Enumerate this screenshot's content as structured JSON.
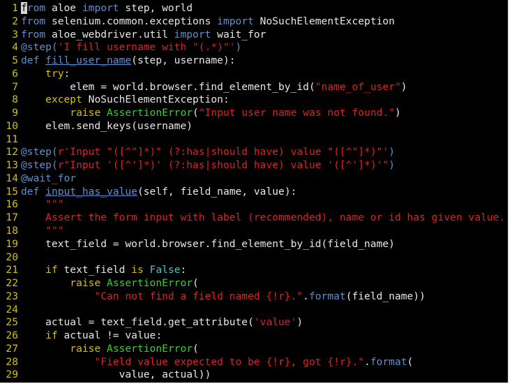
{
  "editor": {
    "colors": {
      "background": "#000000",
      "line_number": "#d7c100",
      "plain": "#e7e7e7",
      "keyword": "#5d8fd1",
      "keyword_alt": "#d8c000",
      "string": "#dc2222",
      "exception": "#3dc93d",
      "builtin_value": "#47c0c8"
    },
    "lines": [
      {
        "n": "1",
        "tokens": [
          {
            "t": "f",
            "k": "cursor"
          },
          {
            "t": "rom",
            "k": "keyword"
          },
          {
            "t": " aloe ",
            "k": "plain"
          },
          {
            "t": "import",
            "k": "keyword"
          },
          {
            "t": " step, world",
            "k": "plain"
          }
        ]
      },
      {
        "n": "2",
        "tokens": [
          {
            "t": "from",
            "k": "keyword"
          },
          {
            "t": " selenium.common.exceptions ",
            "k": "plain"
          },
          {
            "t": "import",
            "k": "keyword"
          },
          {
            "t": " NoSuchElementException",
            "k": "plain"
          }
        ]
      },
      {
        "n": "3",
        "tokens": [
          {
            "t": "from",
            "k": "keyword"
          },
          {
            "t": " aloe_webdriver.util ",
            "k": "plain"
          },
          {
            "t": "import",
            "k": "keyword"
          },
          {
            "t": " wait_for",
            "k": "plain"
          }
        ]
      },
      {
        "n": "4",
        "tokens": [
          {
            "t": "@step(",
            "k": "decorator"
          },
          {
            "t": "'I fill username with \"(.*)\"'",
            "k": "string"
          },
          {
            "t": ")",
            "k": "decorator"
          }
        ]
      },
      {
        "n": "5",
        "tokens": [
          {
            "t": "def",
            "k": "keyword"
          },
          {
            "t": " ",
            "k": "plain"
          },
          {
            "t": "fill_user_name",
            "k": "func"
          },
          {
            "t": "(step, username):",
            "k": "plain"
          }
        ]
      },
      {
        "n": "6",
        "tokens": [
          {
            "t": "    ",
            "k": "plain"
          },
          {
            "t": "try",
            "k": "keyword2"
          },
          {
            "t": ":",
            "k": "plain"
          }
        ]
      },
      {
        "n": "7",
        "tokens": [
          {
            "t": "        elem = world.browser.find_element_by_id(",
            "k": "plain"
          },
          {
            "t": "\"name_of_user\"",
            "k": "string"
          },
          {
            "t": ")",
            "k": "plain"
          }
        ]
      },
      {
        "n": "8",
        "tokens": [
          {
            "t": "    ",
            "k": "plain"
          },
          {
            "t": "except",
            "k": "keyword2"
          },
          {
            "t": " NoSuchElementException:",
            "k": "plain"
          }
        ]
      },
      {
        "n": "9",
        "tokens": [
          {
            "t": "        ",
            "k": "plain"
          },
          {
            "t": "raise",
            "k": "keyword2"
          },
          {
            "t": " ",
            "k": "plain"
          },
          {
            "t": "AssertionError",
            "k": "exception"
          },
          {
            "t": "(",
            "k": "plain"
          },
          {
            "t": "\"Input user name was not found.\"",
            "k": "string"
          },
          {
            "t": ")",
            "k": "plain"
          }
        ]
      },
      {
        "n": "10",
        "tokens": [
          {
            "t": "    elem.send_keys(username)",
            "k": "plain"
          }
        ]
      },
      {
        "n": "11",
        "tokens": []
      },
      {
        "n": "12",
        "tokens": [
          {
            "t": "@step(",
            "k": "decorator"
          },
          {
            "t": "r'Input \"([^\"]*)\" (?:has|should have) value \"([^\"]*)\"'",
            "k": "string"
          },
          {
            "t": ")",
            "k": "decorator"
          }
        ]
      },
      {
        "n": "13",
        "tokens": [
          {
            "t": "@step(",
            "k": "decorator"
          },
          {
            "t": "r\"Input '([^']*)' (?:has|should have) value '([^']*)'\"",
            "k": "string"
          },
          {
            "t": ")",
            "k": "decorator"
          }
        ]
      },
      {
        "n": "14",
        "tokens": [
          {
            "t": "@wait_for",
            "k": "decorator"
          }
        ]
      },
      {
        "n": "15",
        "tokens": [
          {
            "t": "def",
            "k": "keyword"
          },
          {
            "t": " ",
            "k": "plain"
          },
          {
            "t": "input_has_value",
            "k": "func"
          },
          {
            "t": "(self, field_name, value):",
            "k": "plain"
          }
        ]
      },
      {
        "n": "16",
        "tokens": [
          {
            "t": "    ",
            "k": "plain"
          },
          {
            "t": "\"\"\"",
            "k": "string"
          }
        ]
      },
      {
        "n": "17",
        "tokens": [
          {
            "t": "    ",
            "k": "plain"
          },
          {
            "t": "Assert the form input with label (recommended), name or id has given value.",
            "k": "string"
          }
        ]
      },
      {
        "n": "18",
        "tokens": [
          {
            "t": "    ",
            "k": "plain"
          },
          {
            "t": "\"\"\"",
            "k": "string"
          }
        ]
      },
      {
        "n": "19",
        "tokens": [
          {
            "t": "    text_field = world.browser.find_element_by_id(field_name)",
            "k": "plain"
          }
        ]
      },
      {
        "n": "20",
        "tokens": []
      },
      {
        "n": "21",
        "tokens": [
          {
            "t": "    ",
            "k": "plain"
          },
          {
            "t": "if",
            "k": "keyword2"
          },
          {
            "t": " text_field ",
            "k": "plain"
          },
          {
            "t": "is",
            "k": "keyword2"
          },
          {
            "t": " ",
            "k": "plain"
          },
          {
            "t": "False",
            "k": "bool"
          },
          {
            "t": ":",
            "k": "plain"
          }
        ]
      },
      {
        "n": "22",
        "tokens": [
          {
            "t": "        ",
            "k": "plain"
          },
          {
            "t": "raise",
            "k": "keyword2"
          },
          {
            "t": " ",
            "k": "plain"
          },
          {
            "t": "AssertionError",
            "k": "exception"
          },
          {
            "t": "(",
            "k": "plain"
          }
        ]
      },
      {
        "n": "23",
        "tokens": [
          {
            "t": "            ",
            "k": "plain"
          },
          {
            "t": "\"Can not find a field named {!r}.\"",
            "k": "string"
          },
          {
            "t": ".",
            "k": "plain"
          },
          {
            "t": "format",
            "k": "method"
          },
          {
            "t": "(field_name))",
            "k": "plain"
          }
        ]
      },
      {
        "n": "24",
        "tokens": []
      },
      {
        "n": "25",
        "tokens": [
          {
            "t": "    actual = text_field.get_attribute(",
            "k": "plain"
          },
          {
            "t": "'value'",
            "k": "string"
          },
          {
            "t": ")",
            "k": "plain"
          }
        ]
      },
      {
        "n": "26",
        "tokens": [
          {
            "t": "    ",
            "k": "plain"
          },
          {
            "t": "if",
            "k": "keyword2"
          },
          {
            "t": " actual != value:",
            "k": "plain"
          }
        ]
      },
      {
        "n": "27",
        "tokens": [
          {
            "t": "        ",
            "k": "plain"
          },
          {
            "t": "raise",
            "k": "keyword2"
          },
          {
            "t": " ",
            "k": "plain"
          },
          {
            "t": "AssertionError",
            "k": "exception"
          },
          {
            "t": "(",
            "k": "plain"
          }
        ]
      },
      {
        "n": "28",
        "tokens": [
          {
            "t": "            ",
            "k": "plain"
          },
          {
            "t": "\"Field value expected to be {!r}, got {!r}.\"",
            "k": "string"
          },
          {
            "t": ".",
            "k": "plain"
          },
          {
            "t": "format",
            "k": "method"
          },
          {
            "t": "(",
            "k": "plain"
          }
        ]
      },
      {
        "n": "29",
        "tokens": [
          {
            "t": "                value, actual))",
            "k": "plain"
          }
        ]
      }
    ]
  }
}
